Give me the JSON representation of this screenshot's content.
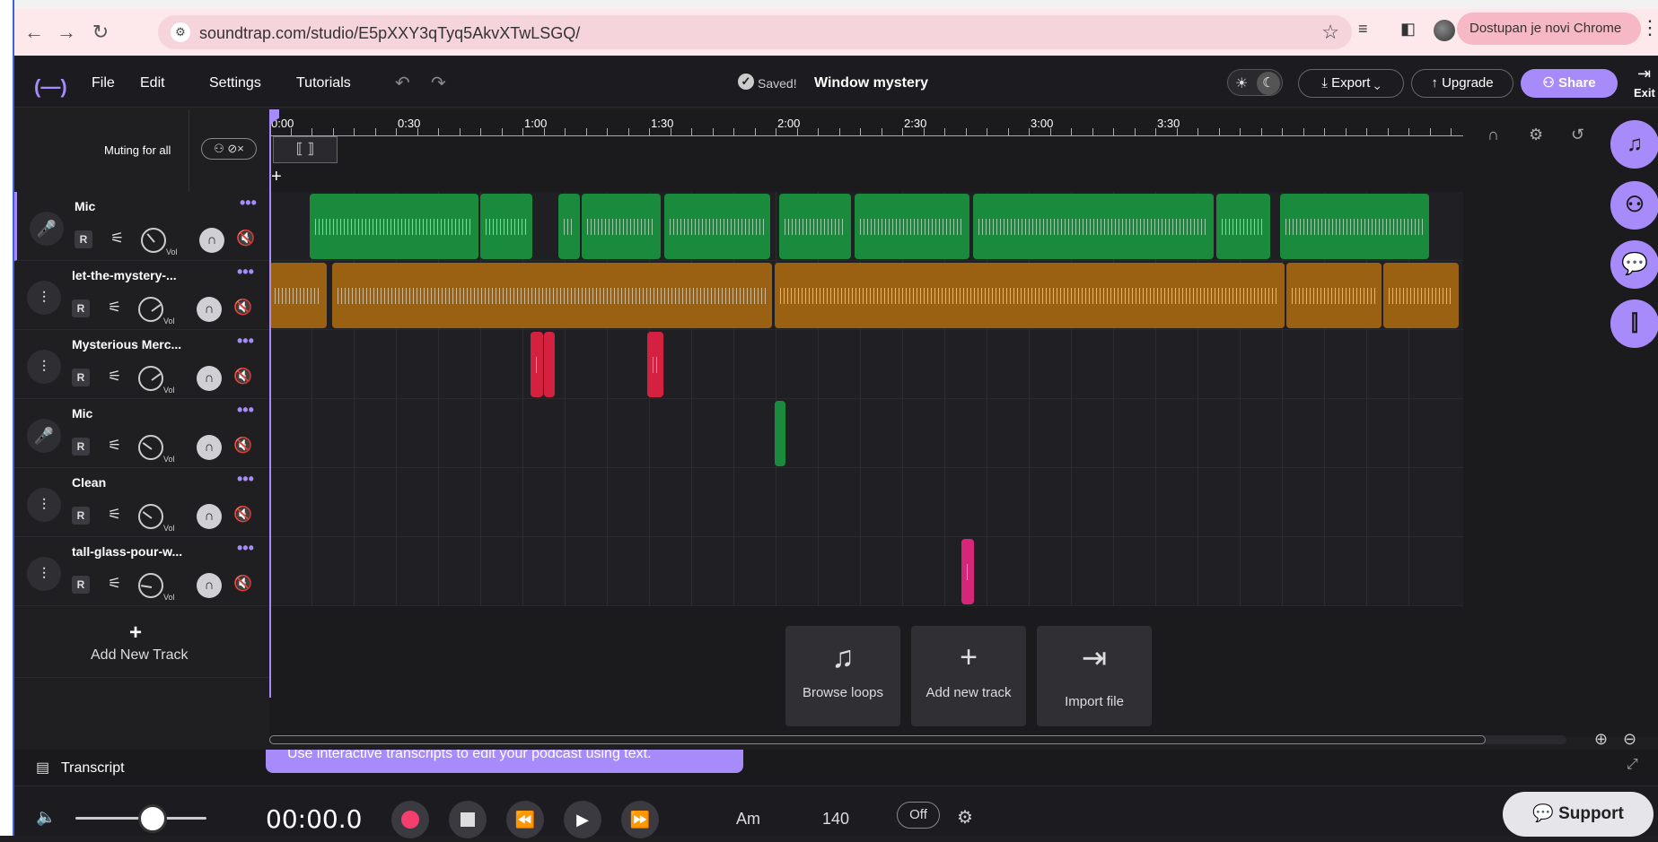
{
  "browser": {
    "url": "soundtrap.com/studio/E5pXXY3qTyq5AkvXTwLSGQ/",
    "update_notice": "Dostupan je novi Chrome"
  },
  "header": {
    "menu": [
      "File",
      "Edit",
      "Settings",
      "Tutorials"
    ],
    "saved_label": "Saved!",
    "project_title": "Window mystery",
    "export_label": "Export",
    "upgrade_label": "Upgrade",
    "share_label": "Share",
    "exit_label": "Exit"
  },
  "muting": {
    "label": "Muting for all"
  },
  "tracks": [
    {
      "name": "Mic",
      "type": "mic",
      "vol": 0.35,
      "color": "#1a8a3c"
    },
    {
      "name": "let-the-mystery-...",
      "type": "audio",
      "vol": 0.7,
      "color": "#9a6112"
    },
    {
      "name": "Mysterious Merc...",
      "type": "audio",
      "vol": 0.7,
      "color": "#d4213f"
    },
    {
      "name": "Mic",
      "type": "mic",
      "vol": 0.3,
      "color": "#1a8a3c"
    },
    {
      "name": "Clean",
      "type": "audio",
      "vol": 0.3,
      "color": "#1a8a3c"
    },
    {
      "name": "tall-glass-pour-w...",
      "type": "audio",
      "vol": 0.2,
      "color": "#d6267a"
    }
  ],
  "track_controls": {
    "record_label": "R",
    "vol_label": "Vol",
    "more_label": "•••"
  },
  "add_track": {
    "label": "Add New Track"
  },
  "ruler": {
    "ticks": [
      "0:00",
      "0:30",
      "1:00",
      "1:30",
      "2:00",
      "2:30",
      "3:00",
      "3:30"
    ]
  },
  "add_cards": [
    {
      "label": "Browse loops",
      "icon": "music-note-icon"
    },
    {
      "label": "Add new track",
      "icon": "plus-icon"
    },
    {
      "label": "Import file",
      "icon": "import-icon"
    }
  ],
  "transcript": {
    "label": "Transcript",
    "promo": "Use interactive transcripts to edit your podcast using text."
  },
  "transport": {
    "time": "00:00.0",
    "key": "Am",
    "bpm": "140",
    "metronome": "Off",
    "support_label": "Support"
  },
  "colors": {
    "accent": "#a78bfa",
    "green_clip": "#1a8a3c",
    "orange_clip": "#9a6112",
    "red_clip": "#d4213f",
    "pink_clip": "#d6267a",
    "record": "#f43f6e"
  }
}
